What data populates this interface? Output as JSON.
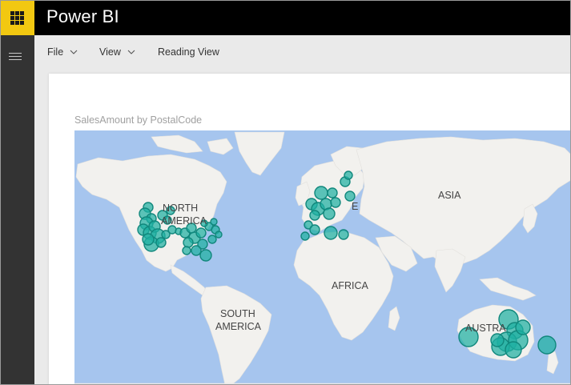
{
  "app": {
    "title": "Power BI"
  },
  "toolbar": {
    "file_label": "File",
    "view_label": "View",
    "reading_view_label": "Reading View"
  },
  "visual": {
    "title": "SalesAmount by PostalCode",
    "marker_color": "#1fb0a2",
    "continent_labels": {
      "north_america_1": "NORTH",
      "north_america_2": "AMERICA",
      "europe_fragment": "E",
      "asia": "ASIA",
      "africa": "AFRICA",
      "south_america_1": "SOUTH",
      "south_america_2": "AMERICA",
      "australia": "AUSTRA"
    }
  },
  "colors": {
    "brand_yellow": "#f2c811",
    "header_black": "#000000",
    "nav_dark": "#333333",
    "ocean": "#a6c5ee",
    "land": "#f2f1ee"
  }
}
